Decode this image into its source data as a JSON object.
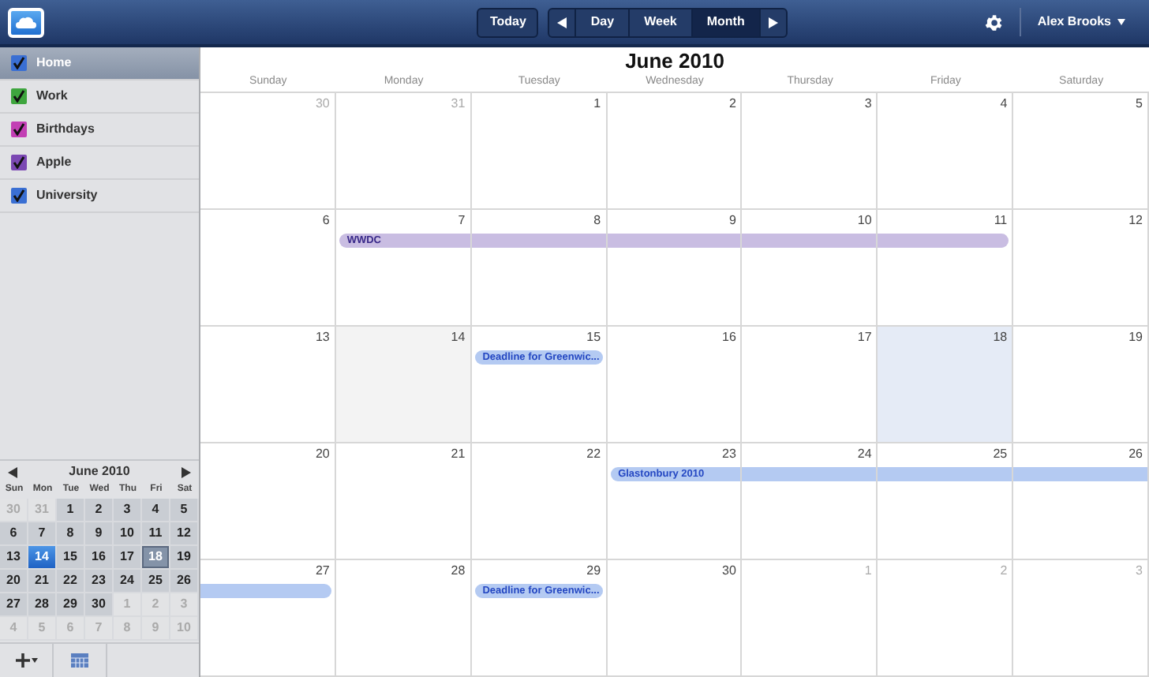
{
  "toolbar": {
    "today": "Today",
    "views": [
      {
        "label": "Day",
        "selected": false
      },
      {
        "label": "Week",
        "selected": false
      },
      {
        "label": "Month",
        "selected": true
      }
    ],
    "user": "Alex Brooks"
  },
  "calendars": [
    {
      "label": "Home",
      "checked": true,
      "color": "#3a6fd3",
      "selected": true
    },
    {
      "label": "Work",
      "checked": true,
      "color": "#3ea53e",
      "selected": false
    },
    {
      "label": "Birthdays",
      "checked": true,
      "color": "#c23fb4",
      "selected": false
    },
    {
      "label": "Apple",
      "checked": true,
      "color": "#7b48b3",
      "selected": false
    },
    {
      "label": "University",
      "checked": true,
      "color": "#3a6fd3",
      "selected": false
    }
  ],
  "mini_calendar": {
    "title": "June 2010",
    "weekdays": [
      "Sun",
      "Mon",
      "Tue",
      "Wed",
      "Thu",
      "Fri",
      "Sat"
    ],
    "weeks": [
      [
        {
          "label": "30",
          "in_month": false,
          "today": false,
          "selected": false
        },
        {
          "label": "31",
          "in_month": false,
          "today": false,
          "selected": false
        },
        {
          "label": "1",
          "in_month": true,
          "today": false,
          "selected": false
        },
        {
          "label": "2",
          "in_month": true,
          "today": false,
          "selected": false
        },
        {
          "label": "3",
          "in_month": true,
          "today": false,
          "selected": false
        },
        {
          "label": "4",
          "in_month": true,
          "today": false,
          "selected": false
        },
        {
          "label": "5",
          "in_month": true,
          "today": false,
          "selected": false
        }
      ],
      [
        {
          "label": "6",
          "in_month": true,
          "today": false,
          "selected": false
        },
        {
          "label": "7",
          "in_month": true,
          "today": false,
          "selected": false
        },
        {
          "label": "8",
          "in_month": true,
          "today": false,
          "selected": false
        },
        {
          "label": "9",
          "in_month": true,
          "today": false,
          "selected": false
        },
        {
          "label": "10",
          "in_month": true,
          "today": false,
          "selected": false
        },
        {
          "label": "11",
          "in_month": true,
          "today": false,
          "selected": false
        },
        {
          "label": "12",
          "in_month": true,
          "today": false,
          "selected": false
        }
      ],
      [
        {
          "label": "13",
          "in_month": true,
          "today": false,
          "selected": false
        },
        {
          "label": "14",
          "in_month": true,
          "today": true,
          "selected": false
        },
        {
          "label": "15",
          "in_month": true,
          "today": false,
          "selected": false
        },
        {
          "label": "16",
          "in_month": true,
          "today": false,
          "selected": false
        },
        {
          "label": "17",
          "in_month": true,
          "today": false,
          "selected": false
        },
        {
          "label": "18",
          "in_month": true,
          "today": false,
          "selected": true
        },
        {
          "label": "19",
          "in_month": true,
          "today": false,
          "selected": false
        }
      ],
      [
        {
          "label": "20",
          "in_month": true,
          "today": false,
          "selected": false
        },
        {
          "label": "21",
          "in_month": true,
          "today": false,
          "selected": false
        },
        {
          "label": "22",
          "in_month": true,
          "today": false,
          "selected": false
        },
        {
          "label": "23",
          "in_month": true,
          "today": false,
          "selected": false
        },
        {
          "label": "24",
          "in_month": true,
          "today": false,
          "selected": false
        },
        {
          "label": "25",
          "in_month": true,
          "today": false,
          "selected": false
        },
        {
          "label": "26",
          "in_month": true,
          "today": false,
          "selected": false
        }
      ],
      [
        {
          "label": "27",
          "in_month": true,
          "today": false,
          "selected": false
        },
        {
          "label": "28",
          "in_month": true,
          "today": false,
          "selected": false
        },
        {
          "label": "29",
          "in_month": true,
          "today": false,
          "selected": false
        },
        {
          "label": "30",
          "in_month": true,
          "today": false,
          "selected": false
        },
        {
          "label": "1",
          "in_month": false,
          "today": false,
          "selected": false
        },
        {
          "label": "2",
          "in_month": false,
          "today": false,
          "selected": false
        },
        {
          "label": "3",
          "in_month": false,
          "today": false,
          "selected": false
        }
      ],
      [
        {
          "label": "4",
          "in_month": false,
          "today": false,
          "selected": false
        },
        {
          "label": "5",
          "in_month": false,
          "today": false,
          "selected": false
        },
        {
          "label": "6",
          "in_month": false,
          "today": false,
          "selected": false
        },
        {
          "label": "7",
          "in_month": false,
          "today": false,
          "selected": false
        },
        {
          "label": "8",
          "in_month": false,
          "today": false,
          "selected": false
        },
        {
          "label": "9",
          "in_month": false,
          "today": false,
          "selected": false
        },
        {
          "label": "10",
          "in_month": false,
          "today": false,
          "selected": false
        }
      ]
    ]
  },
  "month": {
    "title": "June 2010",
    "weekdays": [
      "Sunday",
      "Monday",
      "Tuesday",
      "Wednesday",
      "Thursday",
      "Friday",
      "Saturday"
    ],
    "weeks": [
      [
        {
          "label": "30",
          "in_month": false,
          "today": false,
          "selected": false
        },
        {
          "label": "31",
          "in_month": false,
          "today": false,
          "selected": false
        },
        {
          "label": "1",
          "in_month": true,
          "today": false,
          "selected": false
        },
        {
          "label": "2",
          "in_month": true,
          "today": false,
          "selected": false
        },
        {
          "label": "3",
          "in_month": true,
          "today": false,
          "selected": false
        },
        {
          "label": "4",
          "in_month": true,
          "today": false,
          "selected": false
        },
        {
          "label": "5",
          "in_month": true,
          "today": false,
          "selected": false
        }
      ],
      [
        {
          "label": "6",
          "in_month": true,
          "today": false,
          "selected": false
        },
        {
          "label": "7",
          "in_month": true,
          "today": false,
          "selected": false,
          "events": [
            {
              "kind": "start",
              "title": "WWDC",
              "color": "#c9bde2"
            }
          ]
        },
        {
          "label": "8",
          "in_month": true,
          "today": false,
          "selected": false,
          "events": [
            {
              "kind": "middle",
              "color": "#c9bde2"
            }
          ]
        },
        {
          "label": "9",
          "in_month": true,
          "today": false,
          "selected": false,
          "events": [
            {
              "kind": "middle",
              "color": "#c9bde2"
            }
          ]
        },
        {
          "label": "10",
          "in_month": true,
          "today": false,
          "selected": false,
          "events": [
            {
              "kind": "middle",
              "color": "#c9bde2"
            }
          ]
        },
        {
          "label": "11",
          "in_month": true,
          "today": false,
          "selected": false,
          "events": [
            {
              "kind": "end",
              "color": "#c9bde2"
            }
          ]
        },
        {
          "label": "12",
          "in_month": true,
          "today": false,
          "selected": false
        }
      ],
      [
        {
          "label": "13",
          "in_month": true,
          "today": false,
          "selected": false
        },
        {
          "label": "14",
          "in_month": true,
          "today": true,
          "selected": false
        },
        {
          "label": "15",
          "in_month": true,
          "today": false,
          "selected": false,
          "events": [
            {
              "kind": "single",
              "title": "Deadline for Greenwic...",
              "color": "#b4caf2"
            }
          ]
        },
        {
          "label": "16",
          "in_month": true,
          "today": false,
          "selected": false
        },
        {
          "label": "17",
          "in_month": true,
          "today": false,
          "selected": false
        },
        {
          "label": "18",
          "in_month": true,
          "today": false,
          "selected": true
        },
        {
          "label": "19",
          "in_month": true,
          "today": false,
          "selected": false
        }
      ],
      [
        {
          "label": "20",
          "in_month": true,
          "today": false,
          "selected": false
        },
        {
          "label": "21",
          "in_month": true,
          "today": false,
          "selected": false
        },
        {
          "label": "22",
          "in_month": true,
          "today": false,
          "selected": false
        },
        {
          "label": "23",
          "in_month": true,
          "today": false,
          "selected": false,
          "events": [
            {
              "kind": "start",
              "title": "Glastonbury 2010",
              "color": "#b4caf2"
            }
          ]
        },
        {
          "label": "24",
          "in_month": true,
          "today": false,
          "selected": false,
          "events": [
            {
              "kind": "middle",
              "color": "#b4caf2"
            }
          ]
        },
        {
          "label": "25",
          "in_month": true,
          "today": false,
          "selected": false,
          "events": [
            {
              "kind": "middle",
              "color": "#b4caf2"
            }
          ]
        },
        {
          "label": "26",
          "in_month": true,
          "today": false,
          "selected": false,
          "events": [
            {
              "kind": "middle",
              "color": "#b4caf2"
            }
          ]
        }
      ],
      [
        {
          "label": "27",
          "in_month": true,
          "today": false,
          "selected": false,
          "events": [
            {
              "kind": "end",
              "color": "#b4caf2"
            }
          ]
        },
        {
          "label": "28",
          "in_month": true,
          "today": false,
          "selected": false
        },
        {
          "label": "29",
          "in_month": true,
          "today": false,
          "selected": false,
          "events": [
            {
              "kind": "single",
              "title": "Deadline for Greenwic...",
              "color": "#b4caf2"
            }
          ]
        },
        {
          "label": "30",
          "in_month": true,
          "today": false,
          "selected": false
        },
        {
          "label": "1",
          "in_month": false,
          "today": false,
          "selected": false
        },
        {
          "label": "2",
          "in_month": false,
          "today": false,
          "selected": false
        },
        {
          "label": "3",
          "in_month": false,
          "today": false,
          "selected": false
        }
      ]
    ]
  }
}
